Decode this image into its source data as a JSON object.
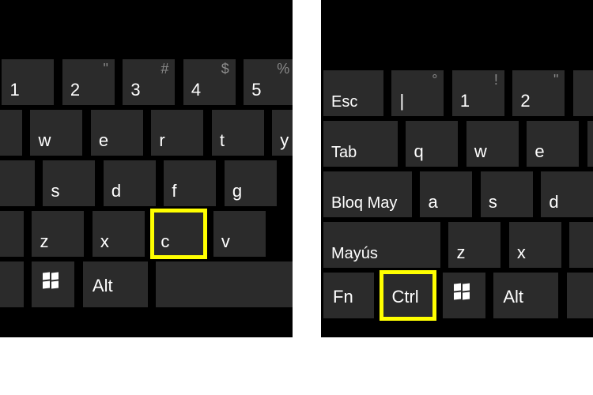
{
  "left_keyboard": {
    "row_number": [
      {
        "main": "1",
        "upper": ""
      },
      {
        "main": "2",
        "upper": "\""
      },
      {
        "main": "3",
        "upper": "#"
      },
      {
        "main": "4",
        "upper": "$"
      },
      {
        "main": "5",
        "upper": "%"
      }
    ],
    "row_qwerty": [
      {
        "main": "w"
      },
      {
        "main": "e"
      },
      {
        "main": "r"
      },
      {
        "main": "t"
      },
      {
        "main": "y"
      }
    ],
    "row_asdf": [
      {
        "main": "s"
      },
      {
        "main": "d"
      },
      {
        "main": "f"
      },
      {
        "main": "g"
      }
    ],
    "row_zxcv": [
      {
        "main": "z"
      },
      {
        "main": "x"
      },
      {
        "main": "c",
        "highlight": true
      },
      {
        "main": "v"
      }
    ],
    "row_bottom": {
      "alt": "Alt"
    }
  },
  "right_keyboard": {
    "row_number": [
      {
        "main": "Esc",
        "wide": true
      },
      {
        "main": "|",
        "upper": "°"
      },
      {
        "main": "1",
        "upper": "!"
      },
      {
        "main": "2",
        "upper": "\""
      }
    ],
    "row_qwerty": [
      {
        "main": "Tab",
        "wide": true
      },
      {
        "main": "q"
      },
      {
        "main": "w"
      },
      {
        "main": "e"
      }
    ],
    "row_asdf": [
      {
        "main": "Bloq May",
        "wide": true
      },
      {
        "main": "a"
      },
      {
        "main": "s"
      },
      {
        "main": "d"
      }
    ],
    "row_zxcv": [
      {
        "main": "Mayús",
        "wide": true
      },
      {
        "main": "z"
      },
      {
        "main": "x"
      }
    ],
    "row_bottom": {
      "fn": "Fn",
      "ctrl": "Ctrl",
      "alt": "Alt"
    }
  }
}
